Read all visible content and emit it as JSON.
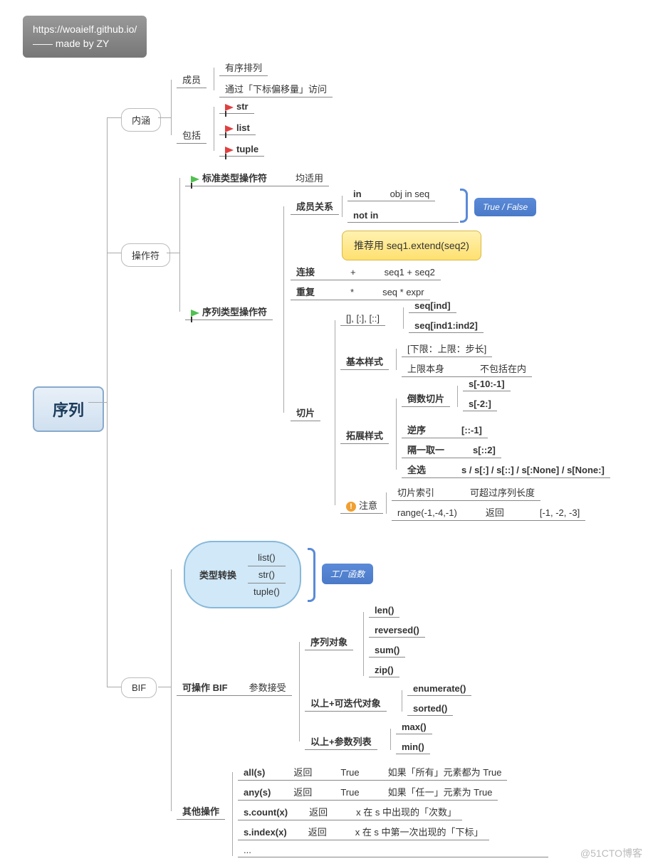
{
  "header": {
    "url": "https://woaielf.github.io/",
    "credit": "—— made by ZY"
  },
  "root": "序列",
  "watermark": "@51CTO博客",
  "b1": {
    "title": "内涵",
    "members": {
      "label": "成员",
      "a": "有序排列",
      "b": "通过「下标偏移量」访问"
    },
    "includes": {
      "label": "包括",
      "a": "str",
      "b": "list",
      "c": "tuple"
    }
  },
  "b2": {
    "title": "操作符",
    "std": {
      "label": "标准类型操作符",
      "note": "均适用"
    },
    "seq": {
      "label": "序列类型操作符",
      "member": {
        "label": "成员关系",
        "in": "in",
        "notin": "not in",
        "eg": "obj in seq",
        "callout": "True / False"
      },
      "concat": {
        "label": "连接",
        "op": "+",
        "eg": "seq1 + seq2",
        "note": "推荐用 seq1.extend(seq2)"
      },
      "repeat": {
        "label": "重复",
        "op": "*",
        "eg": "seq * expr"
      },
      "slice": {
        "label": "切片",
        "idx": {
          "label": "[], [:], [::]",
          "a": "seq[ind]",
          "b": "seq[ind1:ind2]"
        },
        "basic": {
          "label": "基本样式",
          "a": "[下限：上限：步长]",
          "b1": "上限本身",
          "b2": "不包括在内"
        },
        "ext": {
          "label": "拓展样式",
          "rev": {
            "label": "倒数切片",
            "a": "s[-10:-1]",
            "b": "s[-2:]"
          },
          "inv": {
            "label": "逆序",
            "eg": "[::-1]"
          },
          "skip": {
            "label": "隔一取一",
            "eg": "s[::2]"
          },
          "all": {
            "label": "全选",
            "eg": "s / s[:] / s[::] / s[:None] / s[None:]"
          }
        },
        "warn": {
          "label": "注意",
          "a1": "切片索引",
          "a2": "可超过序列长度",
          "b1": "range(-1,-4,-1)",
          "b2": "返回",
          "b3": "[-1, -2, -3]"
        }
      }
    }
  },
  "b3": {
    "title": "BIF",
    "conv": {
      "label": "类型转换",
      "a": "list()",
      "b": "str()",
      "c": "tuple()",
      "callout": "工厂函数"
    },
    "op": {
      "label": "可操作 BIF",
      "param": "参数接受",
      "seqobj": {
        "label": "序列对象",
        "a": "len()",
        "b": "reversed()",
        "c": "sum()",
        "d": "zip()"
      },
      "iter": {
        "label": "以上+可迭代对象",
        "a": "enumerate()",
        "b": "sorted()"
      },
      "args": {
        "label": "以上+参数列表",
        "a": "max()",
        "b": "min()"
      }
    },
    "other": {
      "label": "其他操作",
      "r1": {
        "a": "all(s)",
        "b": "返回",
        "c": "True",
        "d": "如果「所有」元素都为 True"
      },
      "r2": {
        "a": "any(s)",
        "b": "返回",
        "c": "True",
        "d": "如果「任一」元素为 True"
      },
      "r3": {
        "a": "s.count(x)",
        "b": "返回",
        "c": "x 在 s 中出现的「次数」"
      },
      "r4": {
        "a": "s.index(x)",
        "b": "返回",
        "c": "x 在 s 中第一次出现的「下标」"
      },
      "r5": {
        "a": "..."
      }
    }
  }
}
